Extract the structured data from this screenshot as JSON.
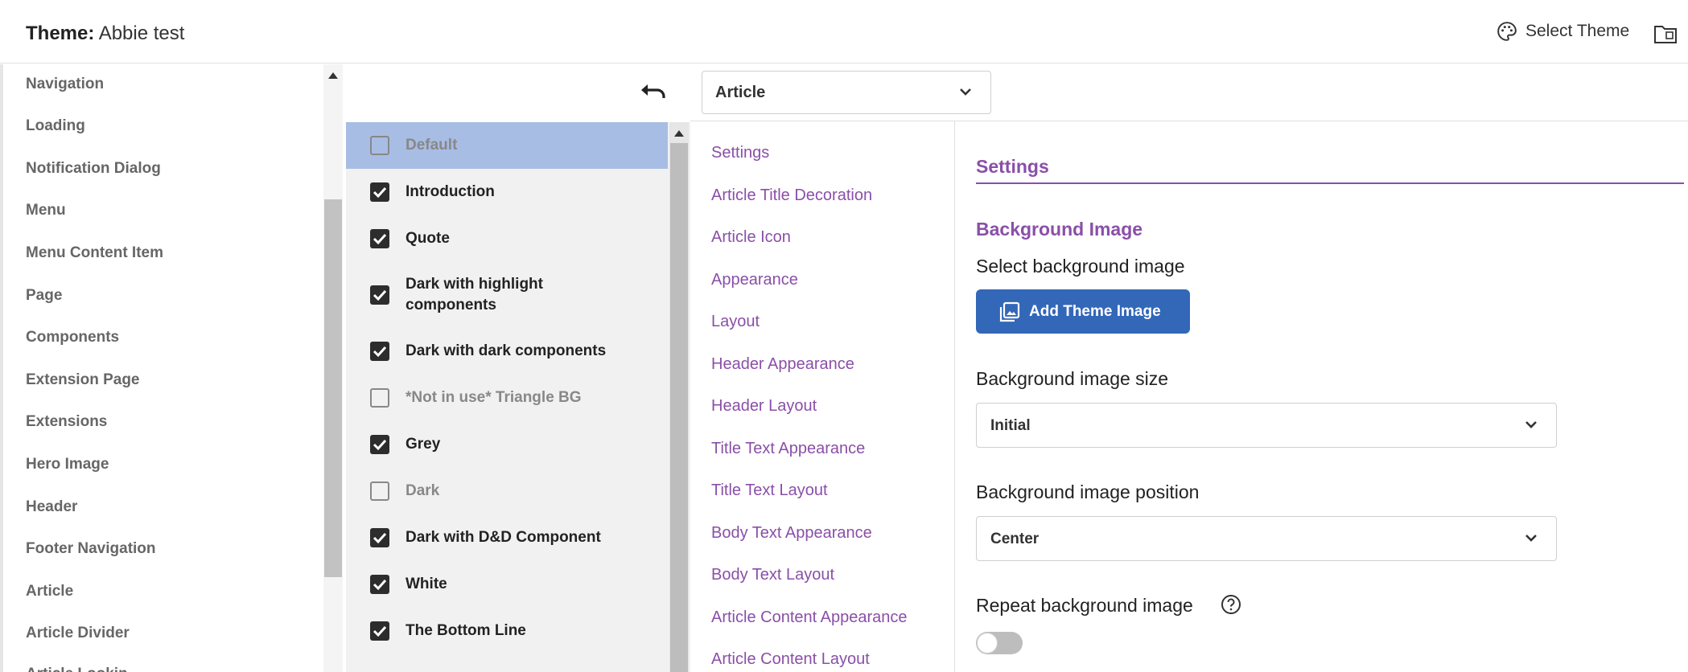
{
  "header": {
    "title_label": "Theme:",
    "title_value": "Abbie test",
    "select_theme_label": "Select Theme"
  },
  "leftnav": {
    "items": [
      "Navigation",
      "Loading",
      "Notification Dialog",
      "Menu",
      "Menu Content Item",
      "Page",
      "Components",
      "Extension Page",
      "Extensions",
      "Hero Image",
      "Header",
      "Footer Navigation",
      "Article",
      "Article Divider",
      "Article Lookin..."
    ]
  },
  "variants": {
    "items": [
      {
        "label": "Default",
        "checked": false,
        "selected": true
      },
      {
        "label": "Introduction",
        "checked": true,
        "selected": false
      },
      {
        "label": "Quote",
        "checked": true,
        "selected": false
      },
      {
        "label": "Dark with highlight components",
        "checked": true,
        "selected": false
      },
      {
        "label": "Dark with dark components",
        "checked": true,
        "selected": false
      },
      {
        "label": "*Not in use* Triangle BG",
        "checked": false,
        "selected": false
      },
      {
        "label": "Grey",
        "checked": true,
        "selected": false
      },
      {
        "label": "Dark",
        "checked": false,
        "selected": false
      },
      {
        "label": "Dark with D&D Component",
        "checked": true,
        "selected": false
      },
      {
        "label": "White",
        "checked": true,
        "selected": false
      },
      {
        "label": "The Bottom Line",
        "checked": true,
        "selected": false
      }
    ]
  },
  "component_select": {
    "value": "Article"
  },
  "subnav": {
    "links": [
      "Settings",
      "Article Title Decoration",
      "Article Icon",
      "Appearance",
      "Layout",
      "Header Appearance",
      "Header Layout",
      "Title Text Appearance",
      "Title Text Layout",
      "Body Text Appearance",
      "Body Text Layout",
      "Article Content Appearance",
      "Article Content Layout"
    ]
  },
  "panel": {
    "settings_heading": "Settings",
    "bg_heading": "Background Image",
    "select_bg_label": "Select background image",
    "add_image_button": "Add Theme Image",
    "size_label": "Background image size",
    "size_value": "Initial",
    "position_label": "Background image position",
    "position_value": "Center",
    "repeat_label": "Repeat background image",
    "repeat_on": false
  },
  "colors": {
    "accent": "#8a4fa8",
    "primary_button": "#3367b8",
    "selected_row": "#a8bde4"
  }
}
